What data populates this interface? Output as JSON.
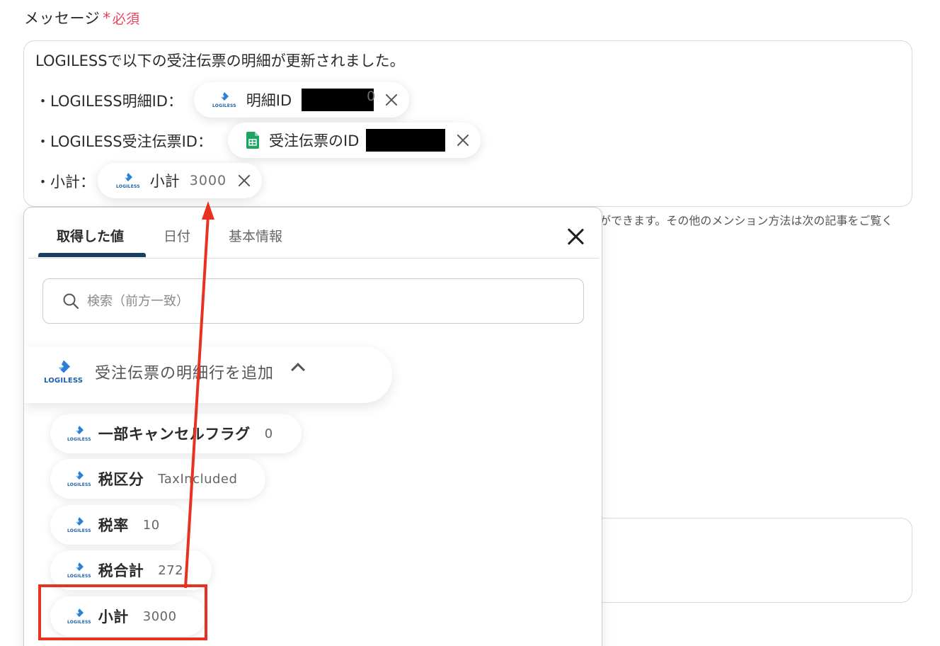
{
  "field": {
    "label": "メッセージ",
    "required_mark": "*",
    "required_text": "必須"
  },
  "editor": {
    "line1": "LOGILESSで以下の受注伝票の明細が更新されました。",
    "line2_prefix": "・LOGILESS明細ID：",
    "line3_prefix": "・LOGILESS受注伝票ID：",
    "line4_prefix": "・小計：",
    "tag1": {
      "label": "明細ID",
      "value": "0",
      "icon": "logiless-logo"
    },
    "tag2": {
      "label": "受注伝票のID",
      "value": "",
      "icon": "google-sheets-icon"
    },
    "tag3": {
      "label": "小計",
      "value": "3000",
      "icon": "logiless-logo"
    }
  },
  "hint": "ができます。その他のメンション方法は次の記事をご覧く",
  "panel": {
    "tabs": [
      "取得した値",
      "日付",
      "基本情報"
    ],
    "active_tab": 0,
    "search_placeholder": "検索（前方一致）",
    "group_title": "受注伝票の明細行を追加",
    "items": [
      {
        "label": "一部キャンセルフラグ",
        "value": "0"
      },
      {
        "label": "税区分",
        "value": "TaxIncluded"
      },
      {
        "label": "税率",
        "value": "10"
      },
      {
        "label": "税合計",
        "value": "272"
      },
      {
        "label": "小計",
        "value": "3000"
      }
    ]
  },
  "logo_text": "LOGILESS",
  "colors": {
    "accent_red": "#e8321f",
    "required_pink": "#e8455b",
    "tab_underline": "#1a3f66",
    "logiless_blue": "#1a5fa8",
    "sheets_green": "#1ea362"
  }
}
